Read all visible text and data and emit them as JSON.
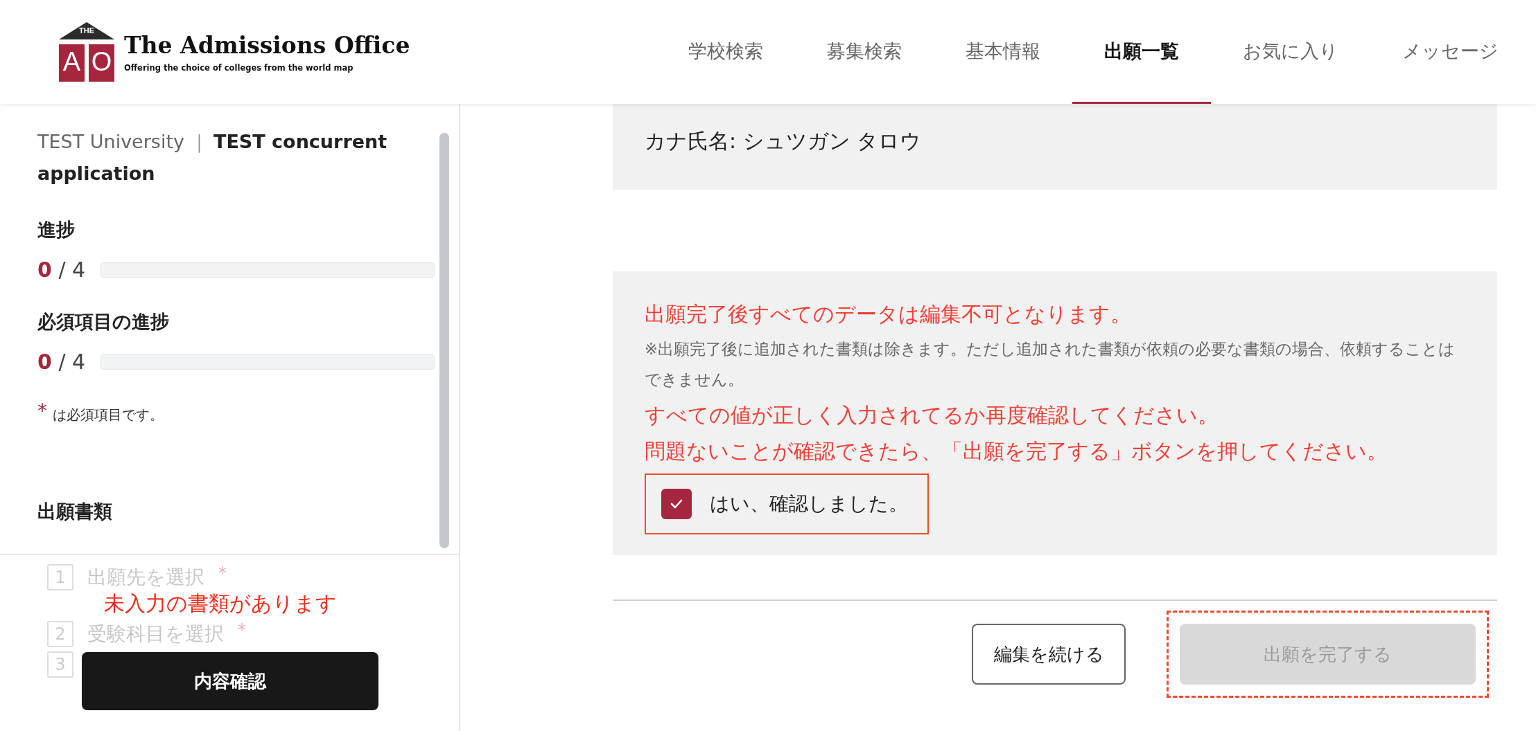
{
  "header": {
    "logo": {
      "top": "THE",
      "letters": [
        "A",
        "O"
      ],
      "title": "The Admissions Office",
      "tagline": "Offering the choice of colleges from the world map"
    },
    "nav": [
      {
        "label": "学校検索",
        "selected": false
      },
      {
        "label": "募集検索",
        "selected": false
      },
      {
        "label": "基本情報",
        "selected": false
      },
      {
        "label": "出願一覧",
        "selected": true
      },
      {
        "label": "お気に入り",
        "selected": false
      },
      {
        "label": "メッセージ",
        "selected": false
      }
    ]
  },
  "sidebar": {
    "university": "TEST University",
    "separator": "｜",
    "program": "TEST concurrent application",
    "progress": [
      {
        "label": "進捗",
        "done": "0",
        "total": "/ 4",
        "level": 0
      },
      {
        "label": "必須項目の進捗",
        "done": "0",
        "total": "/ 4",
        "level": 0
      }
    ],
    "required_note": {
      "mark": "*",
      "text": "は必須項目です。"
    },
    "documents_title": "出願書類",
    "steps": [
      {
        "number": "1",
        "label": "出願先を選択",
        "mark": "*",
        "disabled": true
      },
      {
        "number": "2",
        "label": "受験科目を選択",
        "mark": "*",
        "disabled": true
      },
      {
        "number": "3",
        "disabled": true
      }
    ],
    "error": "未入力の書類があります",
    "confirm_button": "内容確認"
  },
  "main": {
    "applicant": [
      "カナ氏名: シュツガン タロウ"
    ],
    "warning": {
      "heading": "出願完了後すべてのデータは編集不可となります。",
      "note": "※出願完了後に追加された書類は除きます。ただし追加された書類が依頼の必要な書類の場合、依頼することはできません。",
      "lines": [
        "すべての値が正しく入力されてるか再度確認してください。",
        "問題ないことが確認できたら、「出願を完了する」ボタンを押してください。"
      ]
    },
    "confirmation": {
      "label": "はい、確認しました。",
      "checked": true,
      "highlighted": true
    },
    "buttons": [
      {
        "label": "編集を続ける",
        "kind": "secondary",
        "disabled": false,
        "highlighted": false
      },
      {
        "label": "出願を完了する",
        "kind": "primary",
        "disabled": true,
        "highlighted": true
      }
    ]
  }
}
